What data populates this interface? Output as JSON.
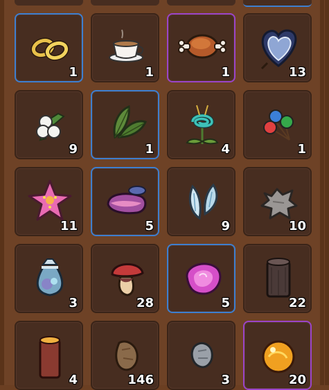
{
  "inventory": {
    "items": [
      {
        "name": "Gold Rings",
        "icon": "gold-rings-icon",
        "count": "1",
        "rarity": "blue"
      },
      {
        "name": "Tea Cup",
        "icon": "tea-cup-icon",
        "count": "1",
        "rarity": "common"
      },
      {
        "name": "Meat",
        "icon": "meat-icon",
        "count": "1",
        "rarity": "purple"
      },
      {
        "name": "Heart Leaf",
        "icon": "heart-leaf-icon",
        "count": "13",
        "rarity": "common"
      },
      {
        "name": "Cotton",
        "icon": "cotton-icon",
        "count": "9",
        "rarity": "common"
      },
      {
        "name": "Leaves",
        "icon": "leaves-icon",
        "count": "1",
        "rarity": "blue"
      },
      {
        "name": "Spiral Flower",
        "icon": "spiral-flower-icon",
        "count": "4",
        "rarity": "common"
      },
      {
        "name": "Berries",
        "icon": "berries-icon",
        "count": "1",
        "rarity": "common"
      },
      {
        "name": "Star Flower",
        "icon": "star-flower-icon",
        "count": "11",
        "rarity": "common"
      },
      {
        "name": "Shell",
        "icon": "shell-icon",
        "count": "5",
        "rarity": "blue"
      },
      {
        "name": "Wings",
        "icon": "wings-icon",
        "count": "9",
        "rarity": "common"
      },
      {
        "name": "Pelt",
        "icon": "pelt-icon",
        "count": "10",
        "rarity": "common"
      },
      {
        "name": "Bag",
        "icon": "bag-icon",
        "count": "3",
        "rarity": "common"
      },
      {
        "name": "Mushroom",
        "icon": "mushroom-icon",
        "count": "28",
        "rarity": "common"
      },
      {
        "name": "Pink Crystal",
        "icon": "pink-crystal-icon",
        "count": "5",
        "rarity": "blue"
      },
      {
        "name": "Dark Log",
        "icon": "dark-log-icon",
        "count": "22",
        "rarity": "common"
      },
      {
        "name": "Log",
        "icon": "log-icon",
        "count": "4",
        "rarity": "common"
      },
      {
        "name": "Stone",
        "icon": "stone-icon",
        "count": "146",
        "rarity": "common"
      },
      {
        "name": "Iron Ore",
        "icon": "iron-ore-icon",
        "count": "3",
        "rarity": "common"
      },
      {
        "name": "Amber Orb",
        "icon": "amber-orb-icon",
        "count": "20",
        "rarity": "purple"
      }
    ]
  },
  "colors": {
    "frame": "#6e4226",
    "slot": "#472d20",
    "blue_rarity": "#3d7fd0",
    "purple_rarity": "#9a44c8"
  }
}
